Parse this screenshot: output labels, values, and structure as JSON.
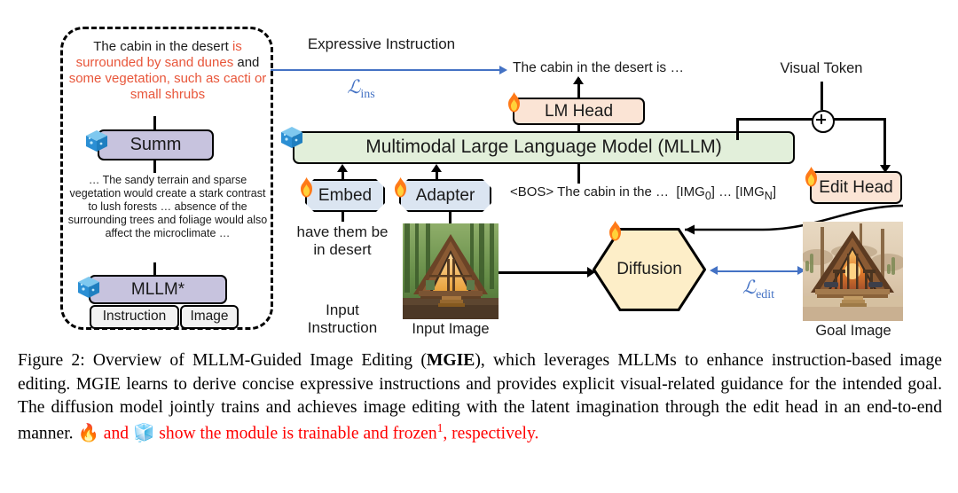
{
  "figure": {
    "dashed_panel": {
      "expressive_output": {
        "seg1": "The cabin in the desert ",
        "seg2": "is surrounded by sand dunes ",
        "seg3": "and ",
        "seg4": "some vegetation, such as cacti or small shrubs"
      },
      "summ_box": {
        "label": "Summ",
        "icon": "frozen-cube-icon"
      },
      "mllm_raw_output": "… The sandy terrain and sparse vegetation would create a stark contrast to lush forests … absence of the surrounding trees and foliage would also affect the microclimate …",
      "mllm_star_box": {
        "label": "MLLM*",
        "icon": "frozen-cube-icon"
      },
      "inputs": [
        {
          "label": "Instruction"
        },
        {
          "label": "Image"
        }
      ]
    },
    "labels": {
      "expressive_instruction": "Expressive Instruction",
      "loss_ins": "ℒins",
      "loss_edit": "ℒedit",
      "visual_token": "Visual Token",
      "generated_instruction": "The cabin in the desert is …",
      "token_sequence": "<BOS> The cabin in the …   [IMG0] … [IMGN]",
      "input_instruction_text": "have them be in desert",
      "input_instruction_caption": "Input Instruction",
      "input_image_caption": "Input Image",
      "goal_image_caption": "Goal Image"
    },
    "blocks": {
      "lm_head": {
        "label": "LM Head",
        "icon": "flame-icon"
      },
      "mllm": {
        "label": "Multimodal Large Language Model (MLLM)",
        "icon": "frozen-cube-icon"
      },
      "embed": {
        "label": "Embed",
        "icon": "flame-icon"
      },
      "adapter": {
        "label": "Adapter",
        "icon": "flame-icon"
      },
      "edit_head": {
        "label": "Edit Head",
        "icon": "flame-icon"
      },
      "diffusion": {
        "label": "Diffusion",
        "icon": "flame-icon"
      },
      "plus": {
        "label": "+"
      }
    },
    "colors": {
      "loss_blue": "#4472c4",
      "expressive_red": "#e8563a",
      "mllm_green": "#e2efda",
      "head_peach": "#fbe4d5",
      "block_blue": "#dbe5f1",
      "summ_lavender": "#c7c3de",
      "diffusion_cream": "#fdeec8",
      "caption_red": "#ff0000"
    }
  },
  "caption": {
    "p1": "Figure 2: Overview of MLLM-Guided Image Editing (",
    "bold1": "MGIE",
    "p2": "), which leverages MLLMs to enhance instruction-based image editing. MGIE learns to derive concise expressive instructions and provides explicit visual-related guidance for the intended goal. The diffusion model jointly trains and achieves image editing with the latent imagination through the edit head in an end-to-end manner. ",
    "flame": "🔥",
    "and": " and ",
    "cube": "🧊",
    "red_tail_a": " show the module is trainable and frozen",
    "footnote": "1",
    "red_tail_b": ", respectively."
  }
}
